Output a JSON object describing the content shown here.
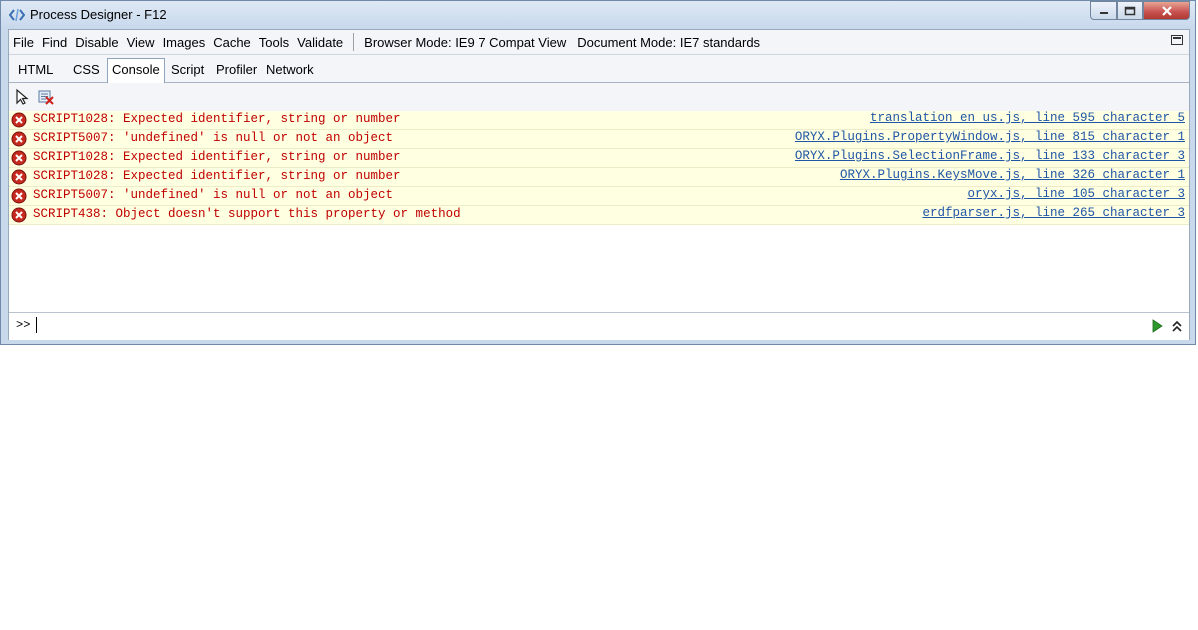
{
  "window": {
    "title": "Process Designer - F12"
  },
  "menubar": {
    "items": [
      {
        "label": "File"
      },
      {
        "label": "Find"
      },
      {
        "label": "Disable"
      },
      {
        "label": "View"
      },
      {
        "label": "Images"
      },
      {
        "label": "Cache"
      },
      {
        "label": "Tools"
      },
      {
        "label": "Validate"
      }
    ],
    "browser_mode": "Browser Mode: IE9 7 Compat View",
    "document_mode": "Document Mode: IE7 standards"
  },
  "tabs": [
    {
      "label": "HTML"
    },
    {
      "label": "CSS"
    },
    {
      "label": "Console",
      "active": true
    },
    {
      "label": "Script"
    },
    {
      "label": "Profiler"
    },
    {
      "label": "Network"
    }
  ],
  "toolbar": {
    "icons": [
      "select-element-icon",
      "clear-console-icon"
    ]
  },
  "console": {
    "messages": [
      {
        "text": "SCRIPT1028: Expected identifier, string or number",
        "source": "translation en us.js, line 595 character 5"
      },
      {
        "text": "SCRIPT5007: 'undefined' is null or not an object",
        "source": "ORYX.Plugins.PropertyWindow.js, line 815 character 1"
      },
      {
        "text": "SCRIPT1028: Expected identifier, string or number",
        "source": "ORYX.Plugins.SelectionFrame.js, line 133 character 3"
      },
      {
        "text": "SCRIPT1028: Expected identifier, string or number",
        "source": "ORYX.Plugins.KeysMove.js, line 326 character 1"
      },
      {
        "text": "SCRIPT5007: 'undefined' is null or not an object",
        "source": "oryx.js, line 105 character 3"
      },
      {
        "text": "SCRIPT438: Object doesn't support this property or method",
        "source": "erdfparser.js, line 265 character 3"
      }
    ],
    "prompt": ">>"
  },
  "colors": {
    "error_text": "#c00000",
    "link": "#1f56a6",
    "row_bg": "#ffffe1"
  }
}
